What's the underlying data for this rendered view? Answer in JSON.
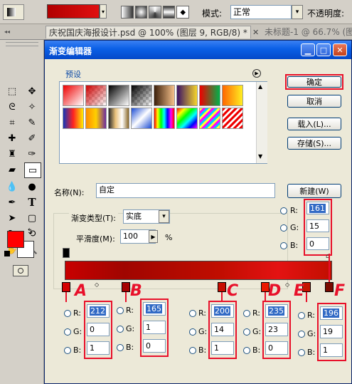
{
  "options_bar": {
    "mode_label": "模式:",
    "mode_value": "正常",
    "opacity_label": "不透明度:"
  },
  "doc_tabs": [
    {
      "label": "庆祝国庆海报设计.psd @ 100% (图层 9, RGB/8) *"
    },
    {
      "label": "未标题-1 @ 66.7% (图层"
    }
  ],
  "dialog": {
    "title": "渐变编辑器",
    "presets_label": "预设",
    "ok_label": "确定",
    "cancel_label": "取消",
    "load_label": "载入(L)...",
    "save_label": "存储(S)...",
    "name_label": "名称(N):",
    "name_value": "自定",
    "new_label": "新建(W)",
    "gradient_type_label": "渐变类型(T):",
    "gradient_type_value": "实底",
    "smoothness_label": "平滑度(M):",
    "smoothness_value": "100",
    "smoothness_unit": "%"
  },
  "top_color": {
    "r": "161",
    "g": "15",
    "b": "0"
  },
  "stops": [
    {
      "letter": "A",
      "r": "212",
      "g": "0",
      "b": "1"
    },
    {
      "letter": "B",
      "r": "165",
      "g": "1",
      "b": "0"
    },
    {
      "letter": "C",
      "r": "200",
      "g": "14",
      "b": "1"
    },
    {
      "letter": "D",
      "r": "235",
      "g": "23",
      "b": "0"
    },
    {
      "letter": "E",
      "r": "196",
      "g": "19",
      "b": "1"
    },
    {
      "letter": "F"
    }
  ],
  "rgb_labels": {
    "r": "R:",
    "g": "G:",
    "b": "B:"
  },
  "colors": {
    "gradient_start": "#b00000",
    "gradient_end": "#e41212",
    "accent_red": "#e8102a",
    "fg_color": "#ff0000"
  }
}
